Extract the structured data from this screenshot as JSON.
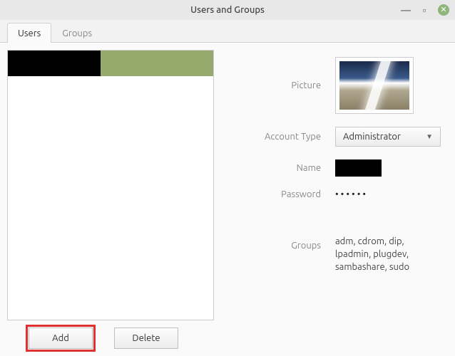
{
  "window": {
    "title": "Users and Groups"
  },
  "tabs": {
    "users": "Users",
    "groups": "Groups",
    "active": "users"
  },
  "details": {
    "picture_label": "Picture",
    "account_type_label": "Account Type",
    "account_type_value": "Administrator",
    "name_label": "Name",
    "password_label": "Password",
    "password_mask": "••••••",
    "groups_label": "Groups",
    "groups_value": "adm, cdrom, dip, lpadmin, plugdev, sambashare, sudo"
  },
  "buttons": {
    "add": "Add",
    "delete": "Delete"
  }
}
